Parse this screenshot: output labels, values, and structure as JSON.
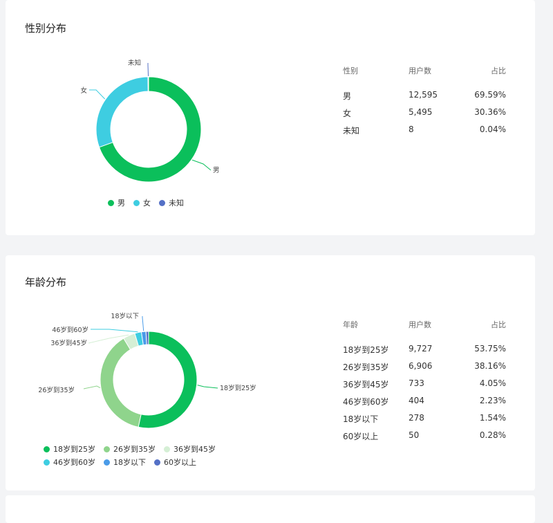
{
  "gender_section": {
    "title": "性别分布",
    "table_headers": [
      "性别",
      "用户数",
      "占比"
    ],
    "rows": [
      {
        "label": "男",
        "count": "12,595",
        "pct": "69.59%"
      },
      {
        "label": "女",
        "count": "5,495",
        "pct": "30.36%"
      },
      {
        "label": "未知",
        "count": "8",
        "pct": "0.04%"
      }
    ]
  },
  "age_section": {
    "title": "年龄分布",
    "table_headers": [
      "年龄",
      "用户数",
      "占比"
    ],
    "rows": [
      {
        "label": "18岁到25岁",
        "count": "9,727",
        "pct": "53.75%"
      },
      {
        "label": "26岁到35岁",
        "count": "6,906",
        "pct": "38.16%"
      },
      {
        "label": "36岁到45岁",
        "count": "733",
        "pct": "4.05%"
      },
      {
        "label": "46岁到60岁",
        "count": "404",
        "pct": "2.23%"
      },
      {
        "label": "18岁以下",
        "count": "278",
        "pct": "1.54%"
      },
      {
        "label": "60岁以上",
        "count": "50",
        "pct": "0.28%"
      }
    ]
  },
  "chart_data": [
    {
      "type": "pie",
      "series": [
        {
          "values": [
            12595,
            5495,
            8
          ]
        }
      ],
      "categories": [
        "男",
        "女",
        "未知"
      ],
      "colors": [
        "#0bbf5b",
        "#3ecde1",
        "#5470c6"
      ],
      "legend": "bottom"
    },
    {
      "type": "pie",
      "series": [
        {
          "values": [
            9727,
            6906,
            733,
            404,
            278,
            50
          ]
        }
      ],
      "categories": [
        "18岁到25岁",
        "26岁到35岁",
        "36岁到45岁",
        "46岁到60岁",
        "18岁以下",
        "60岁以上"
      ],
      "colors": [
        "#0bbf5b",
        "#8fd48c",
        "#d5efd5",
        "#3ecde1",
        "#4a9be8",
        "#5470c6"
      ],
      "legend": "bottom"
    }
  ]
}
